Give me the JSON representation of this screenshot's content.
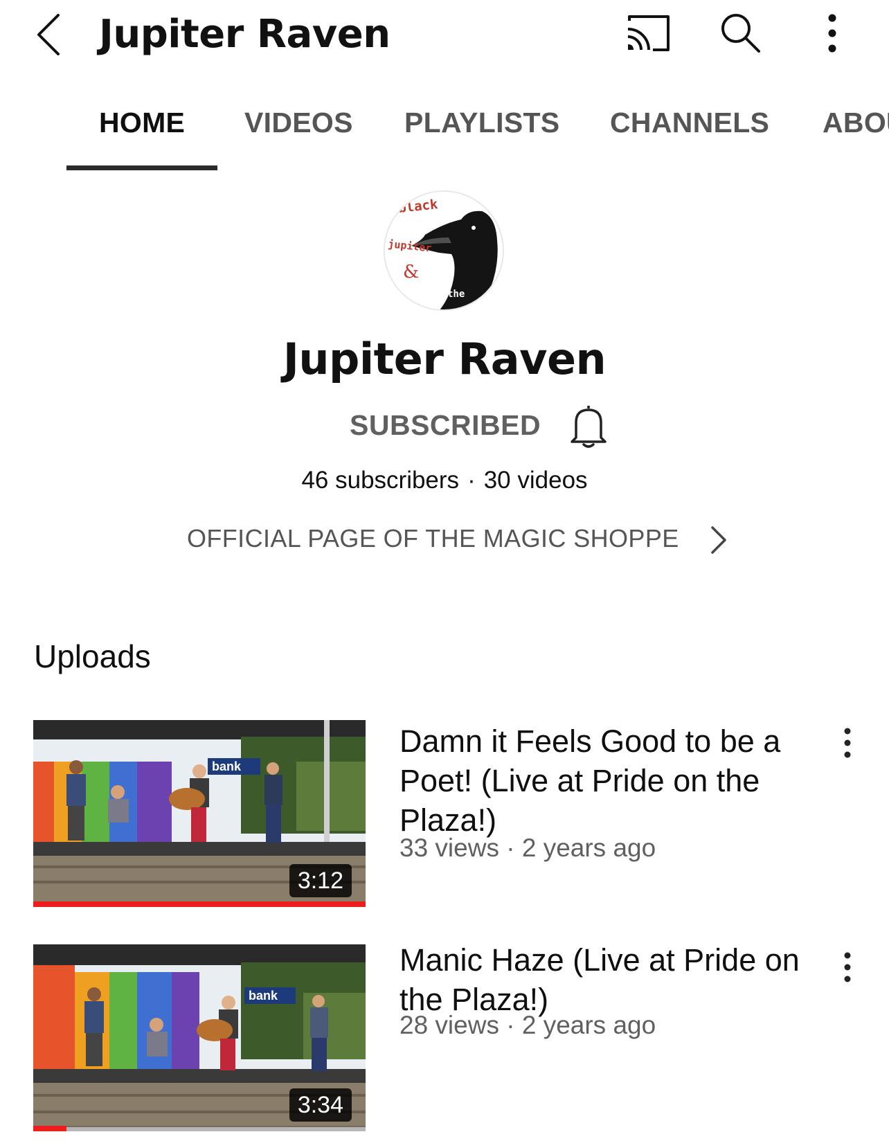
{
  "topbar": {
    "title": "Jupiter Raven",
    "icons": [
      "back-arrow-icon",
      "cast-icon",
      "search-icon",
      "more-vert-icon"
    ]
  },
  "tabs": [
    {
      "label": "HOME",
      "active": true
    },
    {
      "label": "VIDEOS",
      "active": false
    },
    {
      "label": "PLAYLISTS",
      "active": false
    },
    {
      "label": "CHANNELS",
      "active": false
    },
    {
      "label": "ABOUT",
      "active": false
    }
  ],
  "channel": {
    "name": "Jupiter Raven",
    "avatar_text": [
      "black",
      "jupiter",
      "&",
      "the"
    ],
    "subscribe_label": "SUBSCRIBED",
    "subscribers": "46 subscribers",
    "separator": "·",
    "videos": "30 videos",
    "description_link": "OFFICIAL PAGE OF THE MAGIC SHOPPE"
  },
  "uploads": {
    "section_title": "Uploads",
    "items": [
      {
        "title": "Damn it Feels Good to be a Poet! (Live at Pride on the Plaza!)",
        "meta": "33 views · 2 years ago",
        "duration": "3:12",
        "watched_fraction": 1.0,
        "thumbnail_sign_text": "bank"
      },
      {
        "title": "Manic Haze (Live at Pride on the Plaza!)",
        "meta": "28 views · 2 years ago",
        "duration": "3:34",
        "watched_fraction": 0.1,
        "thumbnail_sign_text": "bank"
      }
    ]
  },
  "colors": {
    "progress": "#ee1c1c",
    "secondary_text": "#606060",
    "tab_indicator": "#2b2b2b",
    "logo_red": "#c0392b"
  }
}
